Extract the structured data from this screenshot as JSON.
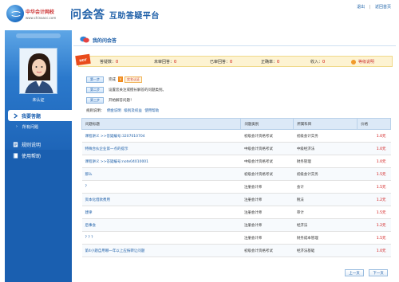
{
  "header": {
    "logo_cn": "中华会计网校",
    "logo_en": "www.chinaacc.com",
    "app_title": "问会答",
    "app_subtitle": "互助答疑平台",
    "links": [
      "退出",
      "返回首页"
    ]
  },
  "sidebar": {
    "user_status": "未认证",
    "nav": {
      "my_answers": "我要答题",
      "all_questions": "所有问题",
      "rules": "规则说明",
      "help": "使用帮助"
    }
  },
  "main": {
    "section_title": "我的问会答",
    "hot_badge": "HOT",
    "stats": {
      "answered_label": "答疑数：",
      "answered_value": "0",
      "unreviewed_label": "未审回答：",
      "unreviewed_value": "0",
      "reviewed_label": "已审回答：",
      "reviewed_value": "0",
      "accuracy_label": "正确率：",
      "accuracy_value": "0",
      "income_label": "收入：",
      "income_value": "0"
    },
    "rules_link": "等级说明",
    "steps": [
      {
        "button": "第一步",
        "text": "完成",
        "badge": "V",
        "link": "实名认证"
      },
      {
        "button": "第二步",
        "text": "设置您关注或擅长解答的问题类别。"
      },
      {
        "button": "第三步",
        "text": "开始解答问题！"
      }
    ],
    "help_line": {
      "label": "规则说明：",
      "links": [
        "佣金说明",
        "级别及权益",
        "使用帮助"
      ]
    },
    "table": {
      "headers": [
        "问题标题",
        "问题类别",
        "所属科目",
        "价格"
      ],
      "rows": [
        [
          "课程讲义 >>答疑编号:3207010704",
          "初级会计资格考试",
          "初级会计实务",
          "1.0元"
        ],
        [
          "特殊合伙企业第一点的提示",
          "中级会计资格考试",
          "中级经济法",
          "1.0元"
        ],
        [
          "课程讲义 >>答疑编号:note04010001",
          "中级会计资格考试",
          "财务管理",
          "1.0元"
        ],
        [
          "那么",
          "初级会计资格考试",
          "初级会计实务",
          "1.5元"
        ],
        [
          "?",
          "注册会计师",
          "会计",
          "1.5元"
        ],
        [
          "资本化借款费用",
          "注册会计师",
          "税法",
          "1.2元"
        ],
        [
          "建律",
          "注册会计师",
          "审计",
          "1.5元"
        ],
        [
          "后事会",
          "注册会计师",
          "经济法",
          "1.2元"
        ],
        [
          "? ? ?",
          "注册会计师",
          "财务成本管理",
          "1.5元"
        ],
        [
          "第4小题自用哪一年以上应按转让问题",
          "初级会计资格考试",
          "经济法基础",
          "1.0元"
        ]
      ]
    },
    "pager": {
      "prev": "上一页",
      "next": "下一页"
    }
  }
}
